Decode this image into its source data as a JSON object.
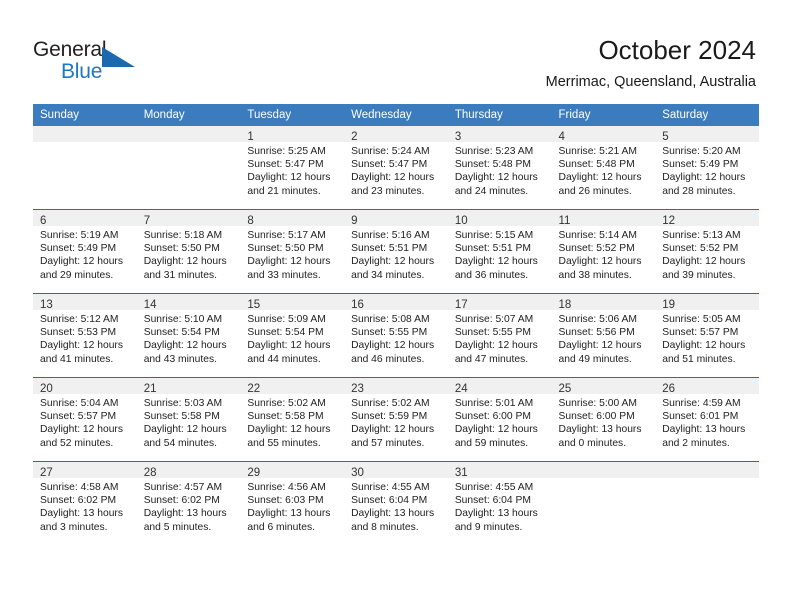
{
  "brand": {
    "name_part1": "General",
    "name_part2": "Blue",
    "accent_color": "#1f76c4",
    "triangle_color": "#1b6aad"
  },
  "header": {
    "title": "October 2024",
    "subtitle": "Merrimac, Queensland, Australia"
  },
  "calendar": {
    "header_bg": "#3a7cbe",
    "row_divider_color": "#2e6da4",
    "daynum_strip_bg": "#f0f0f0",
    "weekday_headers": [
      "Sunday",
      "Monday",
      "Tuesday",
      "Wednesday",
      "Thursday",
      "Friday",
      "Saturday"
    ],
    "weeks": [
      [
        {
          "day": "",
          "empty": true
        },
        {
          "day": "",
          "empty": true
        },
        {
          "day": "1",
          "sunrise": "Sunrise: 5:25 AM",
          "sunset": "Sunset: 5:47 PM",
          "daylight": "Daylight: 12 hours and 21 minutes."
        },
        {
          "day": "2",
          "sunrise": "Sunrise: 5:24 AM",
          "sunset": "Sunset: 5:47 PM",
          "daylight": "Daylight: 12 hours and 23 minutes."
        },
        {
          "day": "3",
          "sunrise": "Sunrise: 5:23 AM",
          "sunset": "Sunset: 5:48 PM",
          "daylight": "Daylight: 12 hours and 24 minutes."
        },
        {
          "day": "4",
          "sunrise": "Sunrise: 5:21 AM",
          "sunset": "Sunset: 5:48 PM",
          "daylight": "Daylight: 12 hours and 26 minutes."
        },
        {
          "day": "5",
          "sunrise": "Sunrise: 5:20 AM",
          "sunset": "Sunset: 5:49 PM",
          "daylight": "Daylight: 12 hours and 28 minutes."
        }
      ],
      [
        {
          "day": "6",
          "sunrise": "Sunrise: 5:19 AM",
          "sunset": "Sunset: 5:49 PM",
          "daylight": "Daylight: 12 hours and 29 minutes."
        },
        {
          "day": "7",
          "sunrise": "Sunrise: 5:18 AM",
          "sunset": "Sunset: 5:50 PM",
          "daylight": "Daylight: 12 hours and 31 minutes."
        },
        {
          "day": "8",
          "sunrise": "Sunrise: 5:17 AM",
          "sunset": "Sunset: 5:50 PM",
          "daylight": "Daylight: 12 hours and 33 minutes."
        },
        {
          "day": "9",
          "sunrise": "Sunrise: 5:16 AM",
          "sunset": "Sunset: 5:51 PM",
          "daylight": "Daylight: 12 hours and 34 minutes."
        },
        {
          "day": "10",
          "sunrise": "Sunrise: 5:15 AM",
          "sunset": "Sunset: 5:51 PM",
          "daylight": "Daylight: 12 hours and 36 minutes."
        },
        {
          "day": "11",
          "sunrise": "Sunrise: 5:14 AM",
          "sunset": "Sunset: 5:52 PM",
          "daylight": "Daylight: 12 hours and 38 minutes."
        },
        {
          "day": "12",
          "sunrise": "Sunrise: 5:13 AM",
          "sunset": "Sunset: 5:52 PM",
          "daylight": "Daylight: 12 hours and 39 minutes."
        }
      ],
      [
        {
          "day": "13",
          "sunrise": "Sunrise: 5:12 AM",
          "sunset": "Sunset: 5:53 PM",
          "daylight": "Daylight: 12 hours and 41 minutes."
        },
        {
          "day": "14",
          "sunrise": "Sunrise: 5:10 AM",
          "sunset": "Sunset: 5:54 PM",
          "daylight": "Daylight: 12 hours and 43 minutes."
        },
        {
          "day": "15",
          "sunrise": "Sunrise: 5:09 AM",
          "sunset": "Sunset: 5:54 PM",
          "daylight": "Daylight: 12 hours and 44 minutes."
        },
        {
          "day": "16",
          "sunrise": "Sunrise: 5:08 AM",
          "sunset": "Sunset: 5:55 PM",
          "daylight": "Daylight: 12 hours and 46 minutes."
        },
        {
          "day": "17",
          "sunrise": "Sunrise: 5:07 AM",
          "sunset": "Sunset: 5:55 PM",
          "daylight": "Daylight: 12 hours and 47 minutes."
        },
        {
          "day": "18",
          "sunrise": "Sunrise: 5:06 AM",
          "sunset": "Sunset: 5:56 PM",
          "daylight": "Daylight: 12 hours and 49 minutes."
        },
        {
          "day": "19",
          "sunrise": "Sunrise: 5:05 AM",
          "sunset": "Sunset: 5:57 PM",
          "daylight": "Daylight: 12 hours and 51 minutes."
        }
      ],
      [
        {
          "day": "20",
          "sunrise": "Sunrise: 5:04 AM",
          "sunset": "Sunset: 5:57 PM",
          "daylight": "Daylight: 12 hours and 52 minutes."
        },
        {
          "day": "21",
          "sunrise": "Sunrise: 5:03 AM",
          "sunset": "Sunset: 5:58 PM",
          "daylight": "Daylight: 12 hours and 54 minutes."
        },
        {
          "day": "22",
          "sunrise": "Sunrise: 5:02 AM",
          "sunset": "Sunset: 5:58 PM",
          "daylight": "Daylight: 12 hours and 55 minutes."
        },
        {
          "day": "23",
          "sunrise": "Sunrise: 5:02 AM",
          "sunset": "Sunset: 5:59 PM",
          "daylight": "Daylight: 12 hours and 57 minutes."
        },
        {
          "day": "24",
          "sunrise": "Sunrise: 5:01 AM",
          "sunset": "Sunset: 6:00 PM",
          "daylight": "Daylight: 12 hours and 59 minutes."
        },
        {
          "day": "25",
          "sunrise": "Sunrise: 5:00 AM",
          "sunset": "Sunset: 6:00 PM",
          "daylight": "Daylight: 13 hours and 0 minutes."
        },
        {
          "day": "26",
          "sunrise": "Sunrise: 4:59 AM",
          "sunset": "Sunset: 6:01 PM",
          "daylight": "Daylight: 13 hours and 2 minutes."
        }
      ],
      [
        {
          "day": "27",
          "sunrise": "Sunrise: 4:58 AM",
          "sunset": "Sunset: 6:02 PM",
          "daylight": "Daylight: 13 hours and 3 minutes."
        },
        {
          "day": "28",
          "sunrise": "Sunrise: 4:57 AM",
          "sunset": "Sunset: 6:02 PM",
          "daylight": "Daylight: 13 hours and 5 minutes."
        },
        {
          "day": "29",
          "sunrise": "Sunrise: 4:56 AM",
          "sunset": "Sunset: 6:03 PM",
          "daylight": "Daylight: 13 hours and 6 minutes."
        },
        {
          "day": "30",
          "sunrise": "Sunrise: 4:55 AM",
          "sunset": "Sunset: 6:04 PM",
          "daylight": "Daylight: 13 hours and 8 minutes."
        },
        {
          "day": "31",
          "sunrise": "Sunrise: 4:55 AM",
          "sunset": "Sunset: 6:04 PM",
          "daylight": "Daylight: 13 hours and 9 minutes."
        },
        {
          "day": "",
          "empty": true
        },
        {
          "day": "",
          "empty": true
        }
      ]
    ]
  }
}
